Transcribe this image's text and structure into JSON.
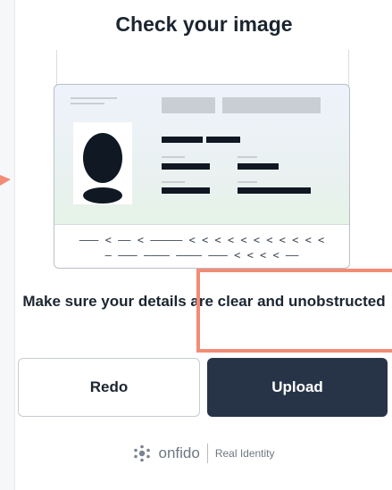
{
  "screen": {
    "title": "Check your image",
    "message": "Make sure your details are clear and unobstructed"
  },
  "id_card": {
    "mrz_line_1": "——— < —— < ————— < < < < < < < < < < <",
    "mrz_line_2": "— ——— ———— ———— ——— < < < < ——"
  },
  "buttons": {
    "redo_label": "Redo",
    "upload_label": "Upload"
  },
  "footer": {
    "brand": "onfido",
    "tagline": "Real Identity"
  },
  "colors": {
    "primary_button": "#273448",
    "highlight": "#f28c76"
  },
  "icons": {
    "brand_logo": "onfido-logo-icon",
    "pointer": "arrow-icon"
  }
}
